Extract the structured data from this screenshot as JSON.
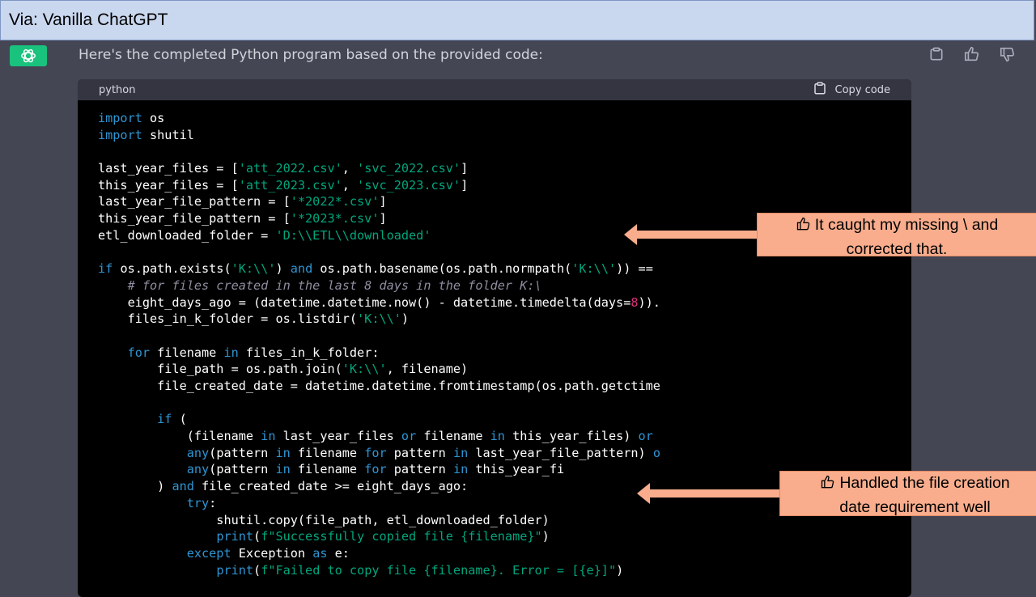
{
  "title_bar": "Via: Vanilla ChatGPT",
  "intro_text": "Here's the completed Python program based on the provided code:",
  "code_language": "python",
  "copy_label": "Copy code",
  "code_lines": [
    [
      {
        "t": "kw",
        "v": "import"
      },
      {
        "t": "",
        "v": " os"
      }
    ],
    [
      {
        "t": "kw",
        "v": "import"
      },
      {
        "t": "",
        "v": " shutil"
      }
    ],
    [],
    [
      {
        "t": "",
        "v": "last_year_files = ["
      },
      {
        "t": "str",
        "v": "'att_2022.csv'"
      },
      {
        "t": "",
        "v": ", "
      },
      {
        "t": "str",
        "v": "'svc_2022.csv'"
      },
      {
        "t": "",
        "v": "]"
      }
    ],
    [
      {
        "t": "",
        "v": "this_year_files = ["
      },
      {
        "t": "str",
        "v": "'att_2023.csv'"
      },
      {
        "t": "",
        "v": ", "
      },
      {
        "t": "str",
        "v": "'svc_2023.csv'"
      },
      {
        "t": "",
        "v": "]"
      }
    ],
    [
      {
        "t": "",
        "v": "last_year_file_pattern = ["
      },
      {
        "t": "str",
        "v": "'*2022*.csv'"
      },
      {
        "t": "",
        "v": "]"
      }
    ],
    [
      {
        "t": "",
        "v": "this_year_file_pattern = ["
      },
      {
        "t": "str",
        "v": "'*2023*.csv'"
      },
      {
        "t": "",
        "v": "]"
      }
    ],
    [
      {
        "t": "",
        "v": "etl_downloaded_folder = "
      },
      {
        "t": "str",
        "v": "'D:\\\\ETL\\\\downloaded'"
      }
    ],
    [],
    [
      {
        "t": "kw",
        "v": "if"
      },
      {
        "t": "",
        "v": " os.path.exists("
      },
      {
        "t": "str",
        "v": "'K:\\\\'"
      },
      {
        "t": "",
        "v": ") "
      },
      {
        "t": "kw",
        "v": "and"
      },
      {
        "t": "",
        "v": " os.path.basename(os.path.normpath("
      },
      {
        "t": "str",
        "v": "'K:\\\\'"
      },
      {
        "t": "",
        "v": ")) =="
      }
    ],
    [
      {
        "t": "",
        "v": "    "
      },
      {
        "t": "cmt",
        "v": "# for files created in the last 8 days in the folder K:\\"
      }
    ],
    [
      {
        "t": "",
        "v": "    eight_days_ago = (datetime.datetime.now() - datetime.timedelta(days="
      },
      {
        "t": "num",
        "v": "8"
      },
      {
        "t": "",
        "v": "))."
      }
    ],
    [
      {
        "t": "",
        "v": "    files_in_k_folder = os.listdir("
      },
      {
        "t": "str",
        "v": "'K:\\\\'"
      },
      {
        "t": "",
        "v": ")"
      }
    ],
    [],
    [
      {
        "t": "",
        "v": "    "
      },
      {
        "t": "kw",
        "v": "for"
      },
      {
        "t": "",
        "v": " filename "
      },
      {
        "t": "kw",
        "v": "in"
      },
      {
        "t": "",
        "v": " files_in_k_folder:"
      }
    ],
    [
      {
        "t": "",
        "v": "        file_path = os.path.join("
      },
      {
        "t": "str",
        "v": "'K:\\\\'"
      },
      {
        "t": "",
        "v": ", filename)"
      }
    ],
    [
      {
        "t": "",
        "v": "        file_created_date = datetime.datetime.fromtimestamp(os.path.getctime"
      }
    ],
    [],
    [
      {
        "t": "",
        "v": "        "
      },
      {
        "t": "kw",
        "v": "if"
      },
      {
        "t": "",
        "v": " ("
      }
    ],
    [
      {
        "t": "",
        "v": "            (filename "
      },
      {
        "t": "kw",
        "v": "in"
      },
      {
        "t": "",
        "v": " last_year_files "
      },
      {
        "t": "kw",
        "v": "or"
      },
      {
        "t": "",
        "v": " filename "
      },
      {
        "t": "kw",
        "v": "in"
      },
      {
        "t": "",
        "v": " this_year_files) "
      },
      {
        "t": "kw",
        "v": "or"
      }
    ],
    [
      {
        "t": "",
        "v": "            "
      },
      {
        "t": "kw",
        "v": "any"
      },
      {
        "t": "",
        "v": "(pattern "
      },
      {
        "t": "kw",
        "v": "in"
      },
      {
        "t": "",
        "v": " filename "
      },
      {
        "t": "kw",
        "v": "for"
      },
      {
        "t": "",
        "v": " pattern "
      },
      {
        "t": "kw",
        "v": "in"
      },
      {
        "t": "",
        "v": " last_year_file_pattern) "
      },
      {
        "t": "kw",
        "v": "o"
      }
    ],
    [
      {
        "t": "",
        "v": "            "
      },
      {
        "t": "kw",
        "v": "any"
      },
      {
        "t": "",
        "v": "(pattern "
      },
      {
        "t": "kw",
        "v": "in"
      },
      {
        "t": "",
        "v": " filename "
      },
      {
        "t": "kw",
        "v": "for"
      },
      {
        "t": "",
        "v": " pattern "
      },
      {
        "t": "kw",
        "v": "in"
      },
      {
        "t": "",
        "v": " this_year_fi"
      }
    ],
    [
      {
        "t": "",
        "v": "        ) "
      },
      {
        "t": "kw",
        "v": "and"
      },
      {
        "t": "",
        "v": " file_created_date >= eight_days_ago:"
      }
    ],
    [
      {
        "t": "",
        "v": "            "
      },
      {
        "t": "kw",
        "v": "try"
      },
      {
        "t": "",
        "v": ":"
      }
    ],
    [
      {
        "t": "",
        "v": "                shutil.copy(file_path, etl_downloaded_folder)"
      }
    ],
    [
      {
        "t": "",
        "v": "                "
      },
      {
        "t": "kw",
        "v": "print"
      },
      {
        "t": "",
        "v": "("
      },
      {
        "t": "str",
        "v": "f\"Successfully copied file {filename}\""
      },
      {
        "t": "",
        "v": ")"
      }
    ],
    [
      {
        "t": "",
        "v": "            "
      },
      {
        "t": "kw",
        "v": "except"
      },
      {
        "t": "",
        "v": " Exception "
      },
      {
        "t": "kw",
        "v": "as"
      },
      {
        "t": "",
        "v": " e:"
      }
    ],
    [
      {
        "t": "",
        "v": "                "
      },
      {
        "t": "kw",
        "v": "print"
      },
      {
        "t": "",
        "v": "("
      },
      {
        "t": "str",
        "v": "f\"Failed to copy file {filename}. Error = [{e}]\""
      },
      {
        "t": "",
        "v": ")"
      }
    ]
  ],
  "callouts": [
    {
      "line1": "It caught my missing \\ and",
      "line2": "corrected that."
    },
    {
      "line1": "Handled the file creation",
      "line2": "date requirement well"
    }
  ],
  "colors": {
    "keyword": "#2e95d3",
    "string": "#00a67d",
    "comment": "#8e8ea0",
    "number": "#df3079",
    "callout": "#f9ad8d",
    "avatar": "#19c37d"
  },
  "icons": [
    "chatgpt-logo-icon",
    "clipboard-icon",
    "thumbs-up-icon",
    "thumbs-down-icon",
    "thumbs-up-hand-icon"
  ]
}
